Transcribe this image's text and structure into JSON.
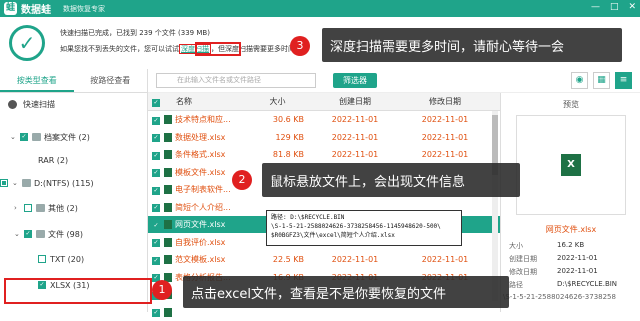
{
  "titlebar": {
    "app_name": "数据蛙",
    "subtitle": "数据恢复专家",
    "logo": "蛙",
    "min": "—",
    "max": "□",
    "close": "✕"
  },
  "status": {
    "line1": "快速扫描已完成，已找到 239 个文件 (339 MB)",
    "line2_pre": "如果您找不到丢失的文件，您可以试试",
    "deep_scan_link": "深度扫描",
    "line2_post": "，但深度扫描需要更多时间。",
    "check": "✓"
  },
  "callouts": {
    "c3": {
      "num": "3",
      "text": "深度扫描需要更多时间，请耐心等待一会"
    },
    "c2": {
      "num": "2",
      "text": "鼠标悬放文件上，会出现文件信息"
    },
    "c1": {
      "num": "1",
      "text": "点击excel文件，查看是不是你要恢复的文件"
    }
  },
  "left_tabs": [
    "按类型查看",
    "按路径查看"
  ],
  "tree": [
    {
      "label": "快速扫描"
    },
    {
      "label": "档案文件 (2)"
    },
    {
      "label": "RAR (2)"
    },
    {
      "label": "D:(NTFS) (115)"
    },
    {
      "label": "其他 (2)"
    },
    {
      "label": "文件 (98)"
    },
    {
      "label": "TXT (20)"
    },
    {
      "label": "XLSX (31)"
    }
  ],
  "toolbar": {
    "search_placeholder": "在此输入文件名或文件路径",
    "filter_label": "筛选器"
  },
  "table": {
    "headers": [
      "名称",
      "大小",
      "创建日期",
      "修改日期"
    ],
    "rows": [
      {
        "name": "技术特点和应...",
        "size": "30.6 KB",
        "created": "2022-11-01",
        "modified": "2022-11-01"
      },
      {
        "name": "数据处理.xlsx",
        "size": "129 KB",
        "created": "2022-11-01",
        "modified": "2022-11-01"
      },
      {
        "name": "条件格式.xlsx",
        "size": "81.8 KB",
        "created": "2022-11-01",
        "modified": "2022-11-01"
      },
      {
        "name": "模板文件.xlsx",
        "size": "",
        "created": "",
        "modified": ""
      },
      {
        "name": "电子制表软件...",
        "size": "",
        "created": "",
        "modified": ""
      },
      {
        "name": "简短个人介绍...",
        "size": "",
        "created": "",
        "modified": ""
      },
      {
        "name": "网页文件.xlsx",
        "size": "",
        "created": "",
        "modified": ""
      },
      {
        "name": "自我评价.xlsx",
        "size": "",
        "created": "",
        "modified": ""
      },
      {
        "name": "范文模板.xlsx",
        "size": "22.5 KB",
        "created": "2022-11-01",
        "modified": "2022-11-01"
      },
      {
        "name": "表格分析报告...",
        "size": "16.9 KB",
        "created": "2022-11-01",
        "modified": "2022-11-01"
      },
      {
        "name": "",
        "size": "",
        "created": "",
        "modified": ""
      },
      {
        "name": "",
        "size": "",
        "created": "",
        "modified": ""
      }
    ]
  },
  "tooltip": {
    "l1": "路径: D:\\$RECYCLE.BIN",
    "l2": "\\S-1-5-21-2588024626-3738258456-1145948620-500\\",
    "l3": "$R0BGFZ3\\文件\\excel\\简短个人介绍.xlsx"
  },
  "preview": {
    "title": "预览",
    "filename": "网页文件.xlsx",
    "info": [
      {
        "k": "大小",
        "v": "16.2 KB"
      },
      {
        "k": "创建日期",
        "v": "2022-11-01"
      },
      {
        "k": "修改日期",
        "v": "2022-11-01"
      },
      {
        "k": "路径",
        "v": "D:\\$RECYCLE.BIN"
      },
      {
        "k": "",
        "v": "\\S-1-5-21-2588024626-3738258"
      }
    ]
  },
  "colors": {
    "accent": "#1fa48a",
    "annotation_red": "#e02020"
  }
}
